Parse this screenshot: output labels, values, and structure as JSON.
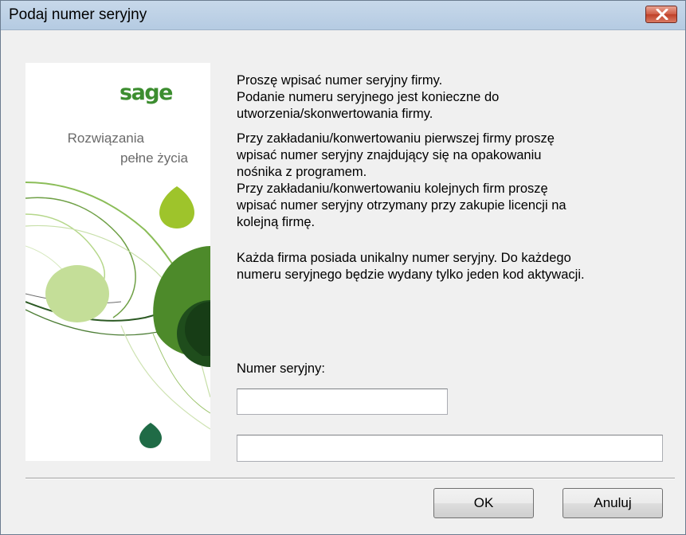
{
  "window": {
    "title": "Podaj numer seryjny",
    "close_icon": "close-icon"
  },
  "side_image": {
    "brand": "sage",
    "tagline_line1": "Rozwiązania",
    "tagline_line2": "pełne życia"
  },
  "instructions": {
    "p1": "Proszę wpisać numer seryjny firmy.\nPodanie numeru seryjnego jest konieczne do\nutworzenia/skonwertowania firmy.",
    "p2": "Przy zakładaniu/konwertowaniu pierwszej firmy proszę\nwpisać numer seryjny znajdujący się na opakowaniu\nnośnika z programem.\nPrzy zakładaniu/konwertowaniu kolejnych firm proszę\nwpisać numer seryjny otrzymany przy zakupie licencji na\nkolejną firmę.",
    "p3": "Każda firma posiada unikalny numer seryjny. Do każdego\nnumeru seryjnego będzie wydany tylko jeden kod aktywacji."
  },
  "form": {
    "serial_label": "Numer seryjny:",
    "serial_value": "",
    "code_value": ""
  },
  "buttons": {
    "ok": "OK",
    "cancel": "Anuluj"
  },
  "colors": {
    "brand_green": "#3c8d2f",
    "dark_green": "#1f4d1c",
    "light_green": "#c4de98"
  }
}
